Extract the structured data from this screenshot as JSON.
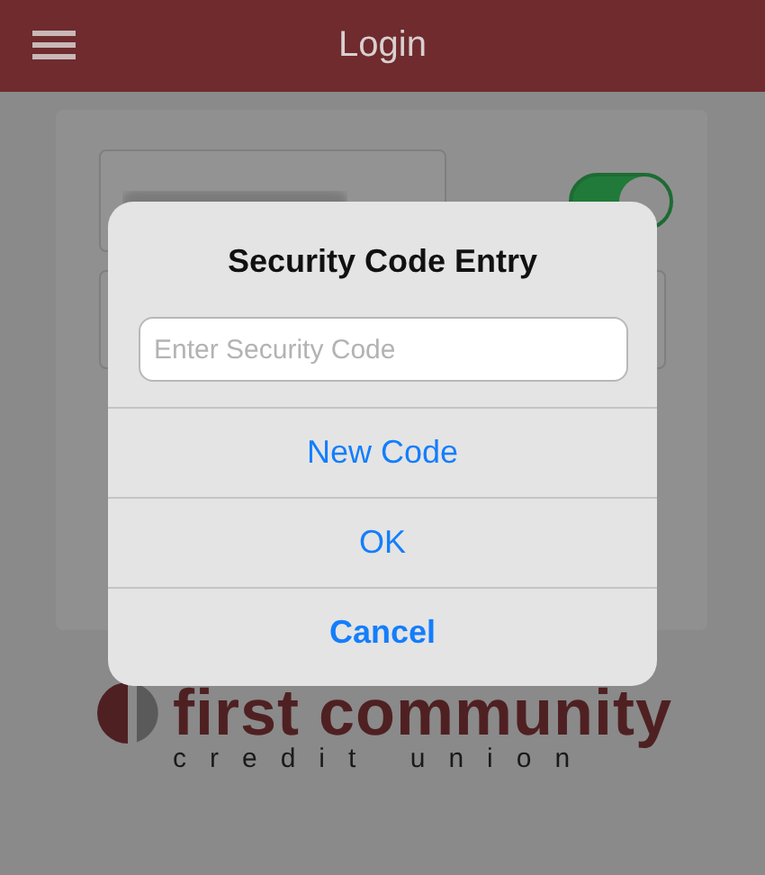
{
  "header": {
    "title": "Login"
  },
  "login_form": {
    "save_toggle": {
      "on": true
    }
  },
  "logo": {
    "name": "first community",
    "tagline": "credit union"
  },
  "dialog": {
    "title": "Security Code Entry",
    "field": {
      "placeholder": "Enter Security Code"
    },
    "buttons": [
      {
        "label": "New Code",
        "kind": "normal"
      },
      {
        "label": "OK",
        "kind": "normal"
      },
      {
        "label": "Cancel",
        "kind": "cancel"
      }
    ]
  }
}
